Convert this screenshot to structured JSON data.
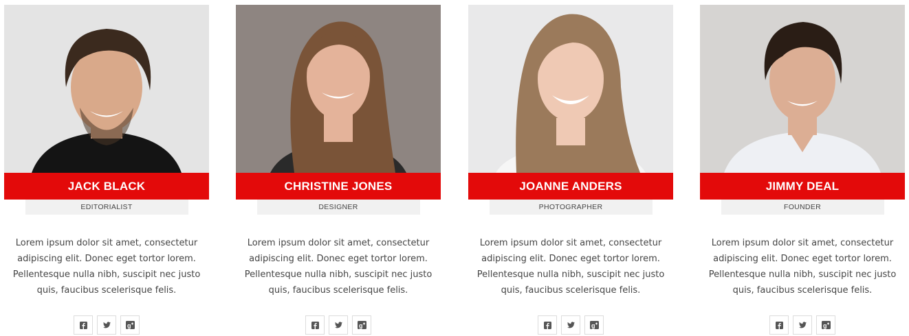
{
  "team": [
    {
      "name": "JACK BLACK",
      "role": "EDITORIALIST",
      "bio": "Lorem ipsum dolor sit amet, consectetur adipiscing elit. Donec eget tortor lorem. Pellentesque nulla nibh, suscipit nec justo quis, faucibus scelerisque felis.",
      "social": [
        "facebook-icon",
        "twitter-icon",
        "google-plus-icon"
      ],
      "photo_bg": "#e4e4e4",
      "hair": "#3b2a1e",
      "skin": "#d9a98a",
      "shirt": "#141414"
    },
    {
      "name": "CHRISTINE JONES",
      "role": "DESIGNER",
      "bio": "Lorem ipsum dolor sit amet, consectetur adipiscing elit. Donec eget tortor lorem. Pellentesque nulla nibh, suscipit nec justo quis, faucibus scelerisque felis.",
      "social": [
        "facebook-icon",
        "twitter-icon",
        "google-plus-icon"
      ],
      "photo_bg": "#8e8581",
      "hair": "#7a5438",
      "skin": "#e4b39a",
      "shirt": "#2a2a2a"
    },
    {
      "name": "JOANNE ANDERS",
      "role": "PHOTOGRAPHER",
      "bio": "Lorem ipsum dolor sit amet, consectetur adipiscing elit. Donec eget tortor lorem. Pellentesque nulla nibh, suscipit nec justo quis, faucibus scelerisque felis.",
      "social": [
        "facebook-icon",
        "twitter-icon",
        "google-plus-icon"
      ],
      "photo_bg": "#e9e9ea",
      "hair": "#9b7a5b",
      "skin": "#efc9b4",
      "shirt": "#f6f6f6"
    },
    {
      "name": "JIMMY DEAL",
      "role": "FOUNDER",
      "bio": "Lorem ipsum dolor sit amet, consectetur adipiscing elit. Donec eget tortor lorem. Pellentesque nulla nibh, suscipit nec justo quis, faucibus scelerisque felis.",
      "social": [
        "facebook-icon",
        "twitter-icon",
        "google-plus-icon"
      ],
      "photo_bg": "#d6d4d2",
      "hair": "#2a1d15",
      "skin": "#dcae94",
      "shirt": "#eef0f4"
    }
  ],
  "colors": {
    "accent": "#e30a0a",
    "role_bg": "#f1f1f1",
    "text": "#444444",
    "icon": "#555555"
  }
}
